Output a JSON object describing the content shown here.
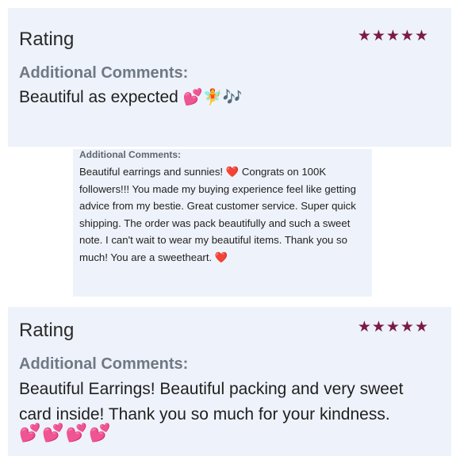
{
  "reviews": [
    {
      "title": "Rating",
      "stars": "★★★★★",
      "comments_label": "Additional Comments:",
      "text": "Beautiful as expected",
      "emojis": "💕🧚🎶"
    },
    {
      "comments_label": "Additional Comments:",
      "text_part1": "Beautiful earrings and sunnies!",
      "heart1": "❤️",
      "text_part2": "Congrats on 100K followers!!! You made my buying experience feel like getting advice from my bestie. Great customer service. Super quick shipping. The order was pack beautifully and such a sweet note. I can't wait to wear my beautiful items. Thank you so much! You are a sweetheart.",
      "heart2": "❤️"
    },
    {
      "title": "Rating",
      "stars": "★★★★★",
      "comments_label": "Additional Comments:",
      "text": "Beautiful Earrings! Beautiful packing and very sweet card inside! Thank you so much for your kindness.",
      "emojis": "💕💕💕💕"
    }
  ],
  "colors": {
    "card_background": "#eef2fa",
    "star": "#7a1a48",
    "label": "#707983",
    "text": "#1f1f1f"
  }
}
